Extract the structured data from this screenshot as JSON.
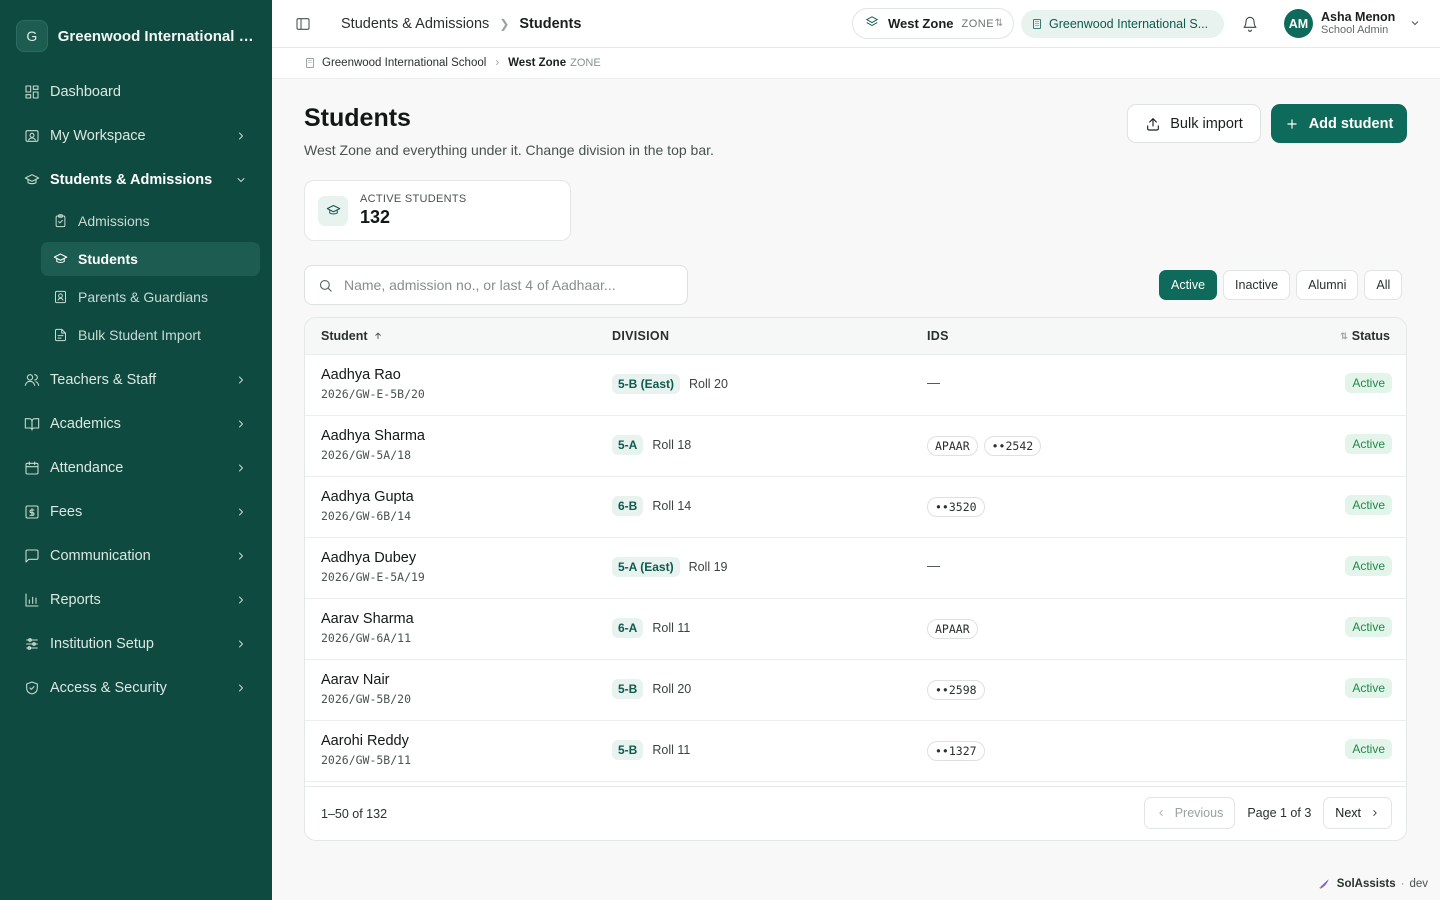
{
  "brand": {
    "initial": "G",
    "name": "Greenwood International Sc..."
  },
  "sidebar": {
    "items": [
      {
        "label": "Dashboard",
        "icon": "layout-dashboard-icon"
      },
      {
        "label": "My Workspace",
        "icon": "id-card-icon"
      },
      {
        "label": "Students & Admissions",
        "icon": "graduation-cap-icon"
      },
      {
        "label": "Teachers & Staff",
        "icon": "users-icon"
      },
      {
        "label": "Academics",
        "icon": "book-open-icon"
      },
      {
        "label": "Attendance",
        "icon": "calendar-icon"
      },
      {
        "label": "Fees",
        "icon": "receipt-icon"
      },
      {
        "label": "Communication",
        "icon": "message-square-icon"
      },
      {
        "label": "Reports",
        "icon": "bar-chart-icon"
      },
      {
        "label": "Institution Setup",
        "icon": "sliders-icon"
      },
      {
        "label": "Access & Security",
        "icon": "shield-check-icon"
      }
    ],
    "sub_items": [
      {
        "label": "Admissions",
        "icon": "clipboard-check-icon"
      },
      {
        "label": "Students",
        "icon": "graduation-cap-icon"
      },
      {
        "label": "Parents & Guardians",
        "icon": "contact-icon"
      },
      {
        "label": "Bulk Student Import",
        "icon": "file-icon"
      }
    ]
  },
  "topbar": {
    "breadcrumb": [
      "Students & Admissions",
      "Students"
    ],
    "zone": {
      "name": "West Zone",
      "tag": "ZONE"
    },
    "school": "Greenwood International S...",
    "user": {
      "initials": "AM",
      "name": "Asha Menon",
      "role": "School Admin"
    }
  },
  "subcrumbs": {
    "school": "Greenwood International School",
    "zone": "West Zone",
    "zone_tag": "ZONE"
  },
  "page": {
    "title": "Students",
    "subtitle": "West Zone and everything under it. Change division in the top bar.",
    "bulk_import_label": "Bulk import",
    "add_student_label": "Add student"
  },
  "stat": {
    "label": "ACTIVE STUDENTS",
    "value": "132"
  },
  "search": {
    "placeholder": "Name, admission no., or last 4 of Aadhaar..."
  },
  "filters": [
    "Active",
    "Inactive",
    "Alumni",
    "All"
  ],
  "table": {
    "columns": {
      "student": "Student",
      "division": "DIVISION",
      "ids": "IDS",
      "status": "Status"
    },
    "rows": [
      {
        "name": "Aadhya Rao",
        "admission": "2026/GW-E-5B/20",
        "division": "5-B (East)",
        "roll": "Roll 20",
        "ids": [],
        "status": "Active"
      },
      {
        "name": "Aadhya Sharma",
        "admission": "2026/GW-5A/18",
        "division": "5-A",
        "roll": "Roll 18",
        "ids": [
          "APAAR",
          "••2542"
        ],
        "status": "Active"
      },
      {
        "name": "Aadhya Gupta",
        "admission": "2026/GW-6B/14",
        "division": "6-B",
        "roll": "Roll 14",
        "ids": [
          "••3520"
        ],
        "status": "Active"
      },
      {
        "name": "Aadhya Dubey",
        "admission": "2026/GW-E-5A/19",
        "division": "5-A (East)",
        "roll": "Roll 19",
        "ids": [],
        "status": "Active"
      },
      {
        "name": "Aarav Sharma",
        "admission": "2026/GW-6A/11",
        "division": "6-A",
        "roll": "Roll 11",
        "ids": [
          "APAAR"
        ],
        "status": "Active"
      },
      {
        "name": "Aarav Nair",
        "admission": "2026/GW-5B/20",
        "division": "5-B",
        "roll": "Roll 20",
        "ids": [
          "••2598"
        ],
        "status": "Active"
      },
      {
        "name": "Aarohi Reddy",
        "admission": "2026/GW-5B/11",
        "division": "5-B",
        "roll": "Roll 11",
        "ids": [
          "••1327"
        ],
        "status": "Active"
      }
    ],
    "empty_id": "—",
    "range": "1–50 of 132",
    "previous_label": "Previous",
    "page_info": "Page 1 of 3",
    "next_label": "Next"
  },
  "footer": {
    "brand": "SolAssists",
    "env": "dev"
  },
  "colors": {
    "sidebar": "#0e4a40",
    "accent": "#0e6a5a",
    "active_badge": "#e3f4ea"
  }
}
